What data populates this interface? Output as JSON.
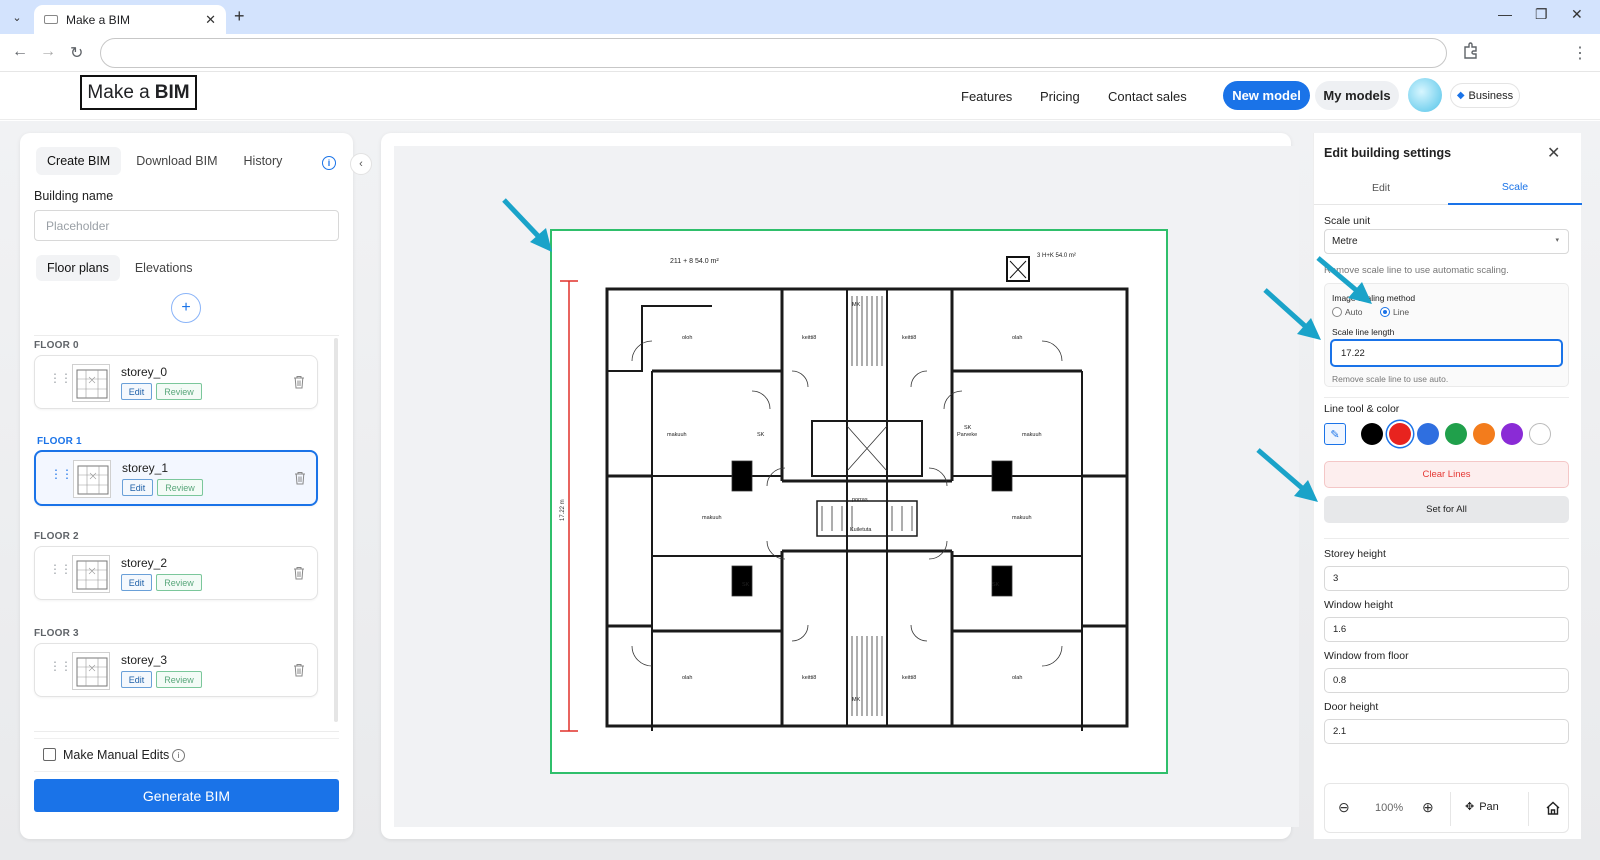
{
  "browser": {
    "tab_title": "Make a BIM",
    "new_tab": "+",
    "tab_menu": "⌄",
    "tab_close": "✕",
    "win_min": "—",
    "win_max": "❐",
    "win_close": "✕",
    "back": "←",
    "forward": "→",
    "reload": "↻",
    "menu": "⋮"
  },
  "header": {
    "logo_prefix": "Make a",
    "logo_bold": "BIM",
    "nav": [
      "Features",
      "Pricing",
      "Contact sales"
    ],
    "new_model": "New model",
    "my_models": "My models",
    "business": "Business",
    "business_icon": "diamond-icon"
  },
  "left_panel": {
    "tabs": [
      "Create BIM",
      "Download BIM",
      "History"
    ],
    "info": "i",
    "collapse": "‹",
    "building_name_label": "Building name",
    "building_name_placeholder": "Placeholder",
    "subtabs": [
      "Floor plans",
      "Elevations"
    ],
    "add": "+",
    "floors": [
      {
        "title": "FLOOR 0",
        "name": "storey_0",
        "edit": "Edit",
        "review": "Review"
      },
      {
        "title": "FLOOR 1",
        "name": "storey_1",
        "edit": "Edit",
        "review": "Review"
      },
      {
        "title": "FLOOR 2",
        "name": "storey_2",
        "edit": "Edit",
        "review": "Review"
      },
      {
        "title": "FLOOR 3",
        "name": "storey_3",
        "edit": "Edit",
        "review": "Review"
      }
    ],
    "drag_glyph": "⋮⋮",
    "manual_edits": "Make Manual Edits",
    "manual_info": "i",
    "generate": "Generate BIM"
  },
  "right_panel": {
    "title": "Edit building settings",
    "close": "✕",
    "tabs": [
      "Edit",
      "Scale"
    ],
    "scale_unit_label": "Scale unit",
    "scale_unit_value": "Metre",
    "select_caret": "▾",
    "hint_remove": "Remove scale line to use automatic scaling.",
    "method_label": "Image scaling method",
    "method_auto": "Auto",
    "method_line": "Line",
    "scale_line_length_label": "Scale line length",
    "scale_line_length_value": "17.22",
    "scale_line_hint": "Remove scale line to use auto.",
    "line_tool_label": "Line tool & color",
    "pen_icon": "✎",
    "colors": [
      "#000000",
      "#e8231f",
      "#2f6fe0",
      "#20a04b",
      "#f37c1c",
      "#8a2bd6",
      "#ffffff"
    ],
    "clear_lines": "Clear Lines",
    "set_for_all": "Set for All",
    "storey_height_label": "Storey height",
    "storey_height_value": "3",
    "window_height_label": "Window height",
    "window_height_value": "1.6",
    "window_from_floor_label": "Window from floor",
    "window_from_floor_value": "0.8",
    "door_height_label": "Door height",
    "door_height_value": "2.1",
    "zoom_out": "⊖",
    "zoom_level": "100%",
    "zoom_in": "⊕",
    "pan": "Pan",
    "pan_icon": "✥"
  },
  "plan": {
    "top_note": "211 + 8    54.0 m²",
    "top_right_note": "3 H+K 54.0 m²",
    "room_labels": [
      "oloh",
      "keitti8",
      "keitti8",
      "olah",
      "makuuh",
      "makuuh",
      "makuuh",
      "makuuh",
      "olah",
      "keitti8",
      "keitti8",
      "olah",
      "porras",
      "Kuiletuta",
      "Parveke",
      "SK",
      "SK",
      "SK",
      "SK",
      "MK",
      "MK"
    ],
    "scale_label": "17.22 m",
    "accent_line": "#e0302a",
    "frame_color": "#2fbf6b"
  },
  "annotation_color": "#1aa3c9"
}
